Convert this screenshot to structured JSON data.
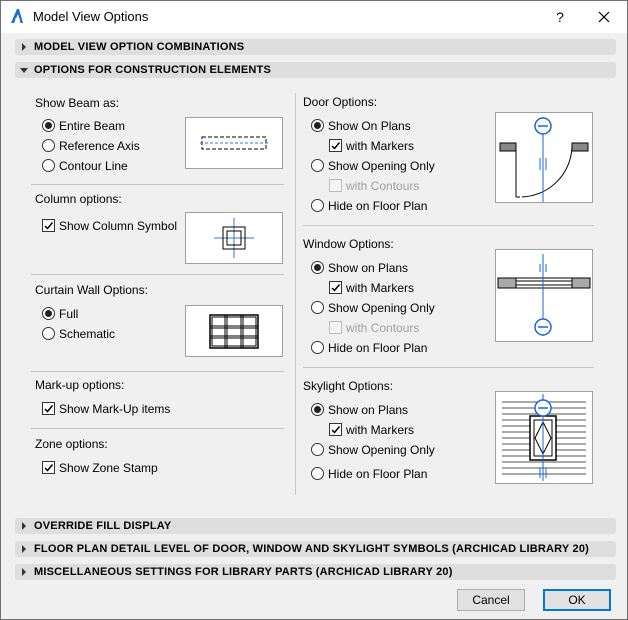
{
  "window": {
    "title": "Model View Options",
    "help": "?"
  },
  "sections": {
    "combinations": "MODEL VIEW OPTION COMBINATIONS",
    "construction": "OPTIONS FOR CONSTRUCTION ELEMENTS",
    "override": "OVERRIDE FILL DISPLAY",
    "floorplan": "FLOOR PLAN DETAIL LEVEL OF DOOR, WINDOW AND SKYLIGHT SYMBOLS (ARCHICAD LIBRARY 20)",
    "misc": "MISCELLANEOUS SETTINGS FOR LIBRARY PARTS (ARCHICAD LIBRARY 20)"
  },
  "beam": {
    "title": "Show Beam as:",
    "options": [
      "Entire Beam",
      "Reference Axis",
      "Contour Line"
    ],
    "selected": 0
  },
  "column": {
    "title": "Column options:",
    "checkbox": "Show Column Symbol",
    "checked": true
  },
  "curtain": {
    "title": "Curtain Wall Options:",
    "options": [
      "Full",
      "Schematic"
    ],
    "selected": 0
  },
  "markup": {
    "title": "Mark-up options:",
    "checkbox": "Show Mark-Up items",
    "checked": true
  },
  "zone": {
    "title": "Zone options:",
    "checkbox": "Show Zone Stamp",
    "checked": true
  },
  "door": {
    "title": "Door Options:",
    "show_on_plans": "Show On Plans",
    "with_markers": "with Markers",
    "show_opening": "Show Opening Only",
    "with_contours": "with Contours",
    "hide": "Hide on Floor Plan"
  },
  "window_opts": {
    "title": "Window Options:",
    "show_on_plans": "Show on Plans",
    "with_markers": "with Markers",
    "show_opening": "Show Opening Only",
    "with_contours": "with Contours",
    "hide": "Hide on Floor Plan"
  },
  "skylight": {
    "title": "Skylight Options:",
    "show_on_plans": "Show on Plans",
    "with_markers": "with Markers",
    "show_opening": "Show Opening Only",
    "hide": "Hide on Floor Plan"
  },
  "buttons": {
    "cancel": "Cancel",
    "ok": "OK"
  },
  "colors": {
    "accent": "#0078d7",
    "marker": "#1a66d6",
    "section_bg": "#dedede"
  }
}
